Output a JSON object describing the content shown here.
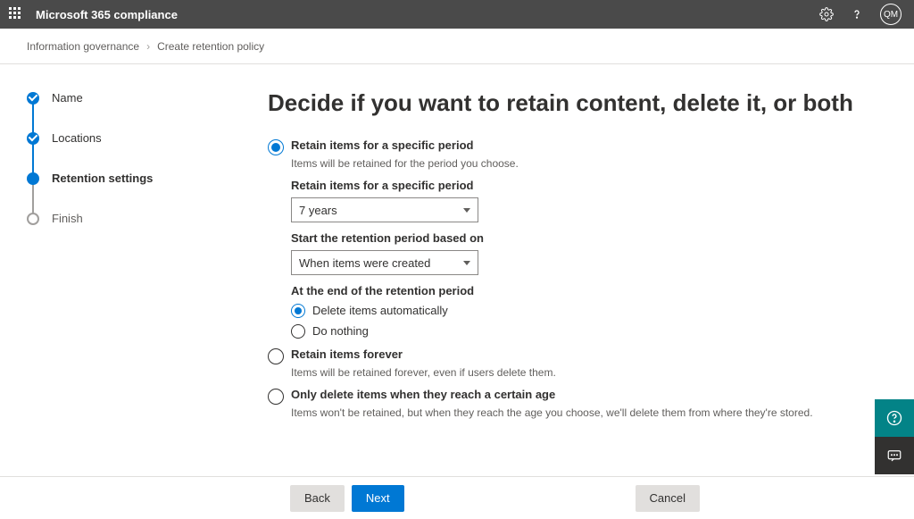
{
  "topbar": {
    "app_title": "Microsoft 365 compliance",
    "avatar_initials": "QM"
  },
  "breadcrumb": {
    "root": "Information governance",
    "current": "Create retention policy"
  },
  "wizard_steps": {
    "name": "Name",
    "locations": "Locations",
    "retention_settings": "Retention settings",
    "finish": "Finish"
  },
  "main": {
    "heading": "Decide if you want to retain content, delete it, or both",
    "opt_retain_period": {
      "label": "Retain items for a specific period",
      "desc": "Items will be retained for the period you choose."
    },
    "sub_retain_label": "Retain items for a specific period",
    "dropdown_retain_value": "7 years",
    "sub_start_label": "Start the retention period based on",
    "dropdown_start_value": "When items were created",
    "sub_end_label": "At the end of the retention period",
    "end_opt_delete": "Delete items automatically",
    "end_opt_nothing": "Do nothing",
    "opt_retain_forever": {
      "label": "Retain items forever",
      "desc": "Items will be retained forever, even if users delete them."
    },
    "opt_only_delete": {
      "label": "Only delete items when they reach a certain age",
      "desc": "Items won't be retained, but when they reach the age you choose, we'll delete them from where they're stored."
    }
  },
  "footer": {
    "back": "Back",
    "next": "Next",
    "cancel": "Cancel"
  }
}
